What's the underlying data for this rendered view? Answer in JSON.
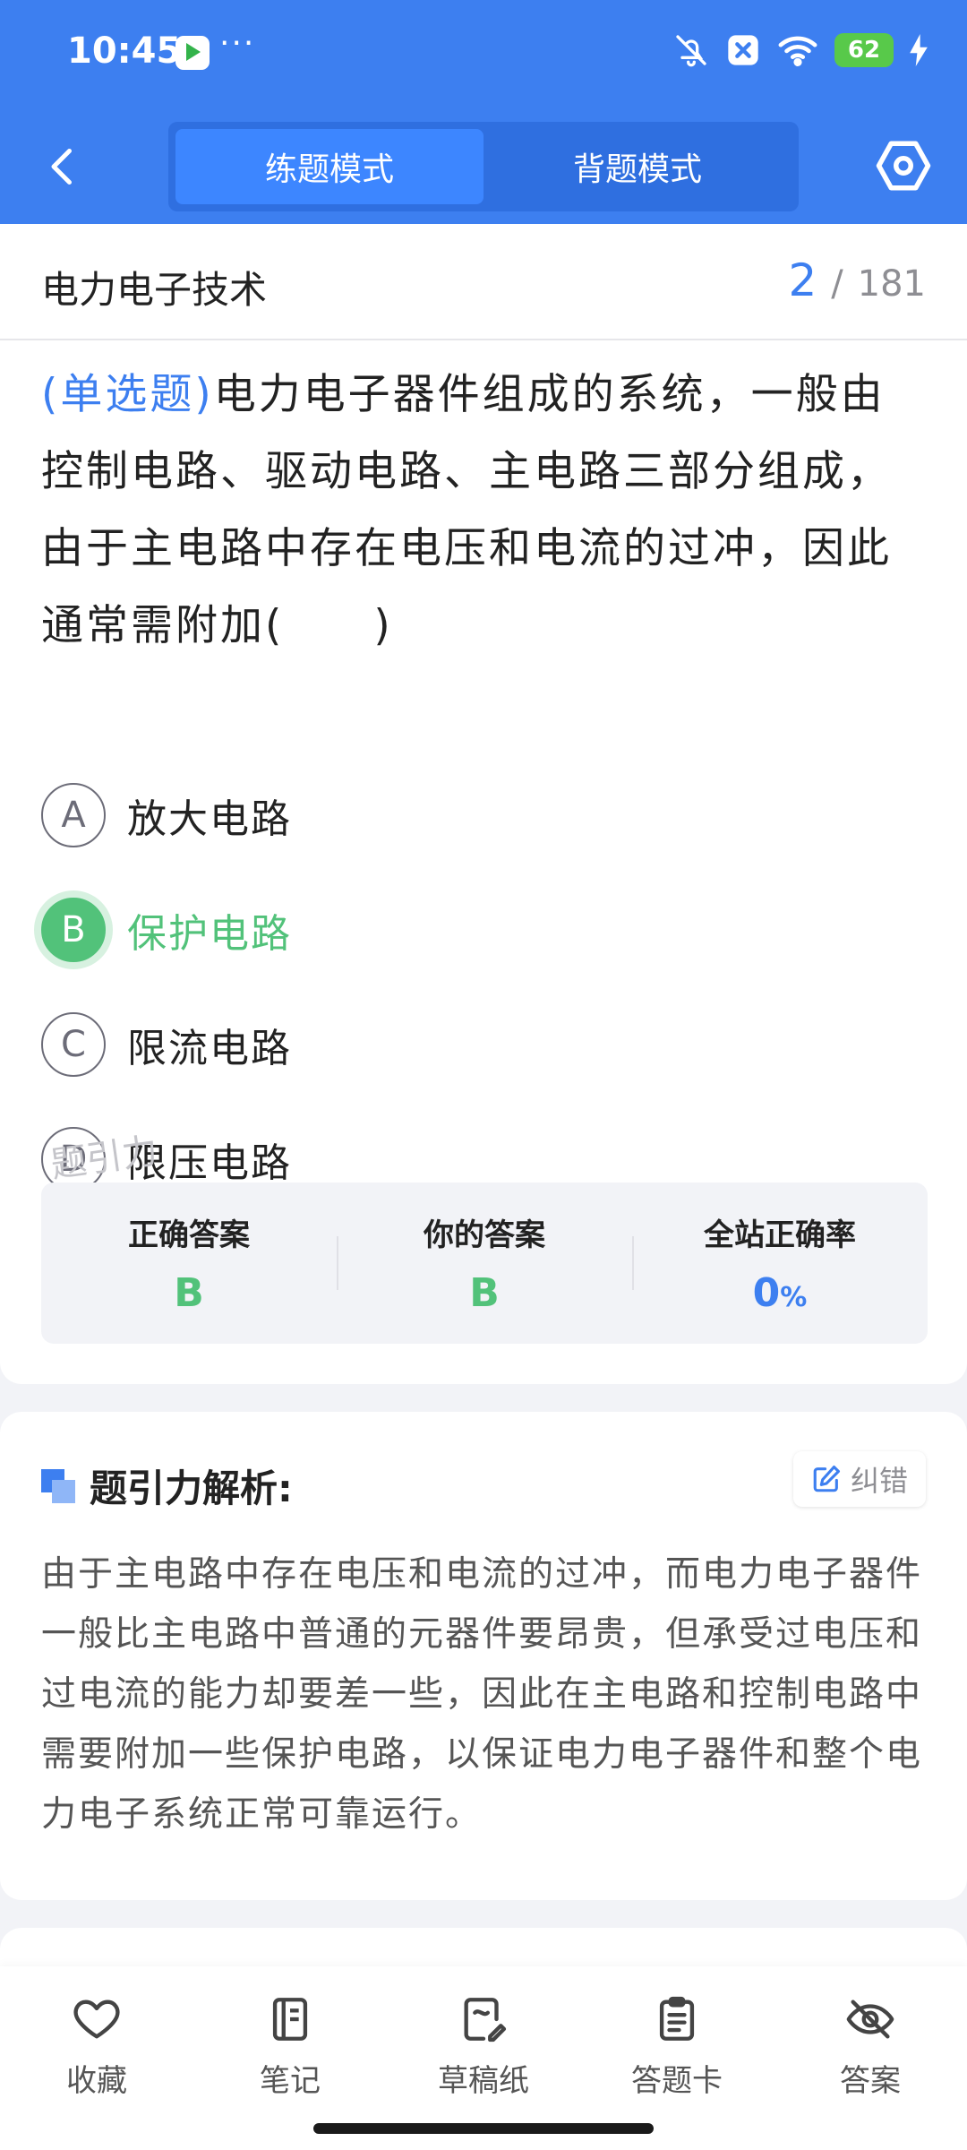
{
  "status_bar": {
    "time": "10:45",
    "more": "···",
    "battery": "62"
  },
  "nav": {
    "tabs": [
      {
        "label": "练题模式",
        "active": true
      },
      {
        "label": "背题模式",
        "active": false
      }
    ]
  },
  "header": {
    "subject": "电力电子技术",
    "current": "2",
    "separator": "/",
    "total": "181"
  },
  "question": {
    "type_label": "(单选题)",
    "text": "电力电子器件组成的系统，一般由控制电路、驱动电路、主电路三部分组成，由于主电路中存在电压和电流的过冲，因此通常需附加(　　)",
    "options": [
      {
        "letter": "A",
        "text": "放大电路"
      },
      {
        "letter": "B",
        "text": "保护电路"
      },
      {
        "letter": "C",
        "text": "限流电路"
      },
      {
        "letter": "D",
        "text": "限压电路"
      }
    ],
    "watermark": "题引力"
  },
  "stats": {
    "correct_label": "正确答案",
    "correct_value": "B",
    "yours_label": "你的答案",
    "yours_value": "B",
    "rate_label": "全站正确率",
    "rate_value": "0",
    "rate_unit": "%"
  },
  "analysis": {
    "title": "题引力解析:",
    "report_label": "纠错",
    "text": "由于主电路中存在电压和电流的过冲，而电力电子器件一般比主电路中普通的元器件要昂贵，但承受过电压和过电流的能力却要差一些，因此在主电路和控制电路中需要附加一些保护电路，以保证电力电子器件和整个电力电子系统正常可靠运行。"
  },
  "bottom_bar": {
    "items": [
      {
        "label": "收藏",
        "icon": "heart-icon"
      },
      {
        "label": "笔记",
        "icon": "notebook-icon"
      },
      {
        "label": "草稿纸",
        "icon": "draft-icon"
      },
      {
        "label": "答题卡",
        "icon": "answer-card-icon"
      },
      {
        "label": "答案",
        "icon": "eye-off-icon"
      }
    ]
  },
  "colors": {
    "primary": "#3d7ff0",
    "correct": "#52c27a"
  }
}
